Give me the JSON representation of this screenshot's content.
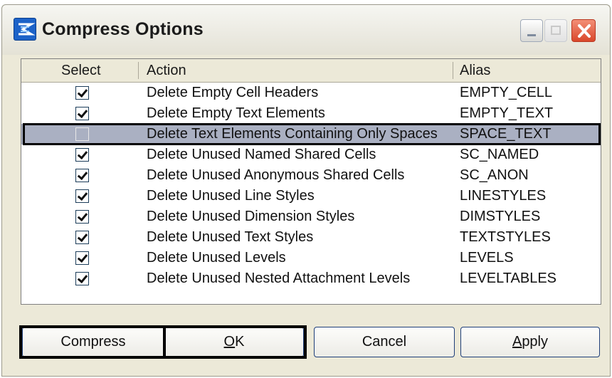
{
  "window": {
    "title": "Compress Options",
    "icon": "app-logo-icon",
    "controls": [
      "minimize-icon",
      "maximize-icon",
      "close-icon"
    ],
    "accent_colors": {
      "close": "#d9472b",
      "selection": "#aab0c2",
      "focus": "#000000"
    }
  },
  "list": {
    "columns": {
      "select": "Select",
      "action": "Action",
      "alias": "Alias"
    },
    "rows": [
      {
        "checked": true,
        "action": "Delete Empty Cell Headers",
        "alias": "EMPTY_CELL"
      },
      {
        "checked": true,
        "action": "Delete Empty Text Elements",
        "alias": "EMPTY_TEXT"
      },
      {
        "checked": false,
        "action": "Delete Text Elements Containing Only Spaces",
        "alias": "SPACE_TEXT",
        "selected": true
      },
      {
        "checked": true,
        "action": "Delete Unused Named Shared Cells",
        "alias": "SC_NAMED"
      },
      {
        "checked": true,
        "action": "Delete Unused Anonymous Shared Cells",
        "alias": "SC_ANON"
      },
      {
        "checked": true,
        "action": "Delete Unused Line Styles",
        "alias": "LINESTYLES"
      },
      {
        "checked": true,
        "action": "Delete Unused Dimension Styles",
        "alias": "DIMSTYLES"
      },
      {
        "checked": true,
        "action": "Delete Unused Text Styles",
        "alias": "TEXTSTYLES"
      },
      {
        "checked": true,
        "action": "Delete Unused Levels",
        "alias": "LEVELS"
      },
      {
        "checked": true,
        "action": "Delete Unused Nested Attachment Levels",
        "alias": "LEVELTABLES"
      }
    ]
  },
  "buttons": {
    "compress": "Compress",
    "ok_accel": "O",
    "ok_rest": "K",
    "cancel": "Cancel",
    "apply_accel": "A",
    "apply_rest": "pply"
  }
}
